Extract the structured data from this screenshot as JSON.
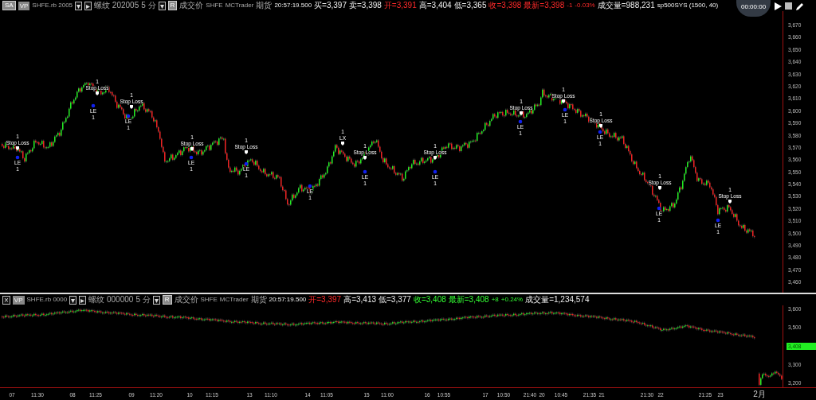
{
  "top_header": [
    {
      "kind": "dropdown",
      "text": "SA"
    },
    {
      "kind": "badge",
      "text": "VP"
    },
    {
      "kind": "label",
      "text": "SHFE.rb 2005"
    },
    {
      "kind": "button",
      "text": "▾"
    },
    {
      "kind": "button",
      "text": "▸"
    },
    {
      "kind": "label",
      "text": "螺纹 202005"
    },
    {
      "kind": "label",
      "text": "5 分"
    },
    {
      "kind": "button",
      "text": "▾"
    },
    {
      "kind": "dropdown",
      "text": "R"
    },
    {
      "kind": "label",
      "text": "成交价"
    },
    {
      "kind": "label",
      "text": "SHFE"
    },
    {
      "kind": "label",
      "text": "MCTrader"
    },
    {
      "kind": "label",
      "text": "期货"
    },
    {
      "kind": "quote",
      "text": "20:57:19.500"
    },
    {
      "kind": "quote",
      "text": "买=3,397"
    },
    {
      "kind": "quote",
      "text": "卖=3,398"
    },
    {
      "kind": "quote_down",
      "text": "开=3,391"
    },
    {
      "kind": "quote",
      "text": "高=3,404"
    },
    {
      "kind": "quote",
      "text": "低=3,365"
    },
    {
      "kind": "quote_down",
      "text": "收=3,398"
    },
    {
      "kind": "quote_down",
      "text": "最新=3,398"
    },
    {
      "kind": "quote_down",
      "text": "-1"
    },
    {
      "kind": "quote_down",
      "text": "-0.03%"
    },
    {
      "kind": "quote",
      "text": "成交量=988,231"
    },
    {
      "kind": "quote",
      "text": "sp500SYS (1500, 40)"
    }
  ],
  "recorder": {
    "time": "00:00:00"
  },
  "main_axis": [
    "3,670",
    "3,660",
    "3,650",
    "3,640",
    "3,630",
    "3,620",
    "3,610",
    "3,600",
    "3,590",
    "3,580",
    "3,570",
    "3,560",
    "3,550",
    "3,540",
    "3,530",
    "3,520",
    "3,510",
    "3,500",
    "3,490",
    "3,480",
    "3,470",
    "3,460"
  ],
  "markers": [
    {
      "kind": "exit",
      "text": "Stop Loss",
      "qty": "1"
    },
    {
      "kind": "entry",
      "text": "LE",
      "qty": "1"
    },
    {
      "kind": "entry",
      "text": "LE",
      "qty": "1"
    },
    {
      "kind": "exit",
      "text": "Stop Loss",
      "qty": "1"
    },
    {
      "kind": "entry",
      "text": "LE",
      "qty": "1"
    },
    {
      "kind": "exit",
      "text": "Stop Loss",
      "qty": "1"
    },
    {
      "kind": "entry",
      "text": "LE",
      "qty": "1"
    },
    {
      "kind": "exit",
      "text": "Stop Loss",
      "qty": "1"
    },
    {
      "kind": "exit",
      "text": "Stop Loss",
      "qty": "1"
    },
    {
      "kind": "entry",
      "text": "LE",
      "qty": "1"
    },
    {
      "kind": "entry",
      "text": "LE",
      "qty": "1"
    },
    {
      "kind": "exit",
      "text": "LX",
      "qty": "1"
    },
    {
      "kind": "exit",
      "text": "Stop Loss",
      "qty": "1"
    },
    {
      "kind": "entry",
      "text": "LE",
      "qty": "1"
    },
    {
      "kind": "exit",
      "text": "Stop Loss",
      "qty": "1"
    },
    {
      "kind": "entry",
      "text": "LE",
      "qty": "1"
    },
    {
      "kind": "entry",
      "text": "LE",
      "qty": "1"
    },
    {
      "kind": "exit",
      "text": "Stop Loss",
      "qty": "1"
    },
    {
      "kind": "exit",
      "text": "Stop Loss",
      "qty": "1"
    },
    {
      "kind": "entry",
      "text": "LE",
      "qty": "1"
    },
    {
      "kind": "exit",
      "text": "Stop Loss",
      "qty": "1"
    },
    {
      "kind": "entry",
      "text": "LE",
      "qty": "1"
    },
    {
      "kind": "entry",
      "text": "LE",
      "qty": "1"
    },
    {
      "kind": "exit",
      "text": "Stop Loss",
      "qty": "1"
    },
    {
      "kind": "entry",
      "text": "LE",
      "qty": "1"
    },
    {
      "kind": "exit",
      "text": "Stop Loss",
      "qty": "1"
    }
  ],
  "lower_header": [
    {
      "kind": "button",
      "text": "×"
    },
    {
      "kind": "badge",
      "text": "VP"
    },
    {
      "kind": "label",
      "text": "SHFE.rb 0000"
    },
    {
      "kind": "button",
      "text": "▾"
    },
    {
      "kind": "button",
      "text": "▸"
    },
    {
      "kind": "label",
      "text": "螺纹 000000"
    },
    {
      "kind": "label",
      "text": "5 分"
    },
    {
      "kind": "button",
      "text": "▾"
    },
    {
      "kind": "dropdown",
      "text": "R"
    },
    {
      "kind": "label",
      "text": "成交价"
    },
    {
      "kind": "label",
      "text": "SHFE"
    },
    {
      "kind": "label",
      "text": "MCTrader"
    },
    {
      "kind": "label",
      "text": "期货"
    },
    {
      "kind": "quote",
      "text": "20:57:19.500"
    },
    {
      "kind": "quote_down",
      "text": "开=3,397"
    },
    {
      "kind": "quote",
      "text": "高=3,413"
    },
    {
      "kind": "quote",
      "text": "低=3,377"
    },
    {
      "kind": "quote_up",
      "text": "收=3,408"
    },
    {
      "kind": "quote_up",
      "text": "最新=3,408"
    },
    {
      "kind": "quote_up",
      "text": "+8"
    },
    {
      "kind": "quote_up",
      "text": "+0.24%"
    },
    {
      "kind": "quote",
      "text": "成交量=1,234,574"
    }
  ],
  "lower_axis": [
    {
      "kind": "tick",
      "text": "3,600"
    },
    {
      "kind": "tick",
      "text": "3,500"
    },
    {
      "kind": "last_price",
      "text": "3,408"
    },
    {
      "kind": "tick",
      "text": "3,300"
    },
    {
      "kind": "tick",
      "text": "3,200"
    }
  ],
  "time_axis": [
    "07",
    "11:30",
    "08",
    "11:25",
    "09",
    "11:20",
    "10",
    "11:15",
    "13",
    "11:10",
    "14",
    "11:05",
    "15",
    "11:00",
    "16",
    "10:55",
    "17",
    "10:50",
    "21:40",
    "20",
    "10:45",
    "21:35",
    "21",
    "21:30",
    "22",
    "21:25",
    "23",
    "2月"
  ]
}
